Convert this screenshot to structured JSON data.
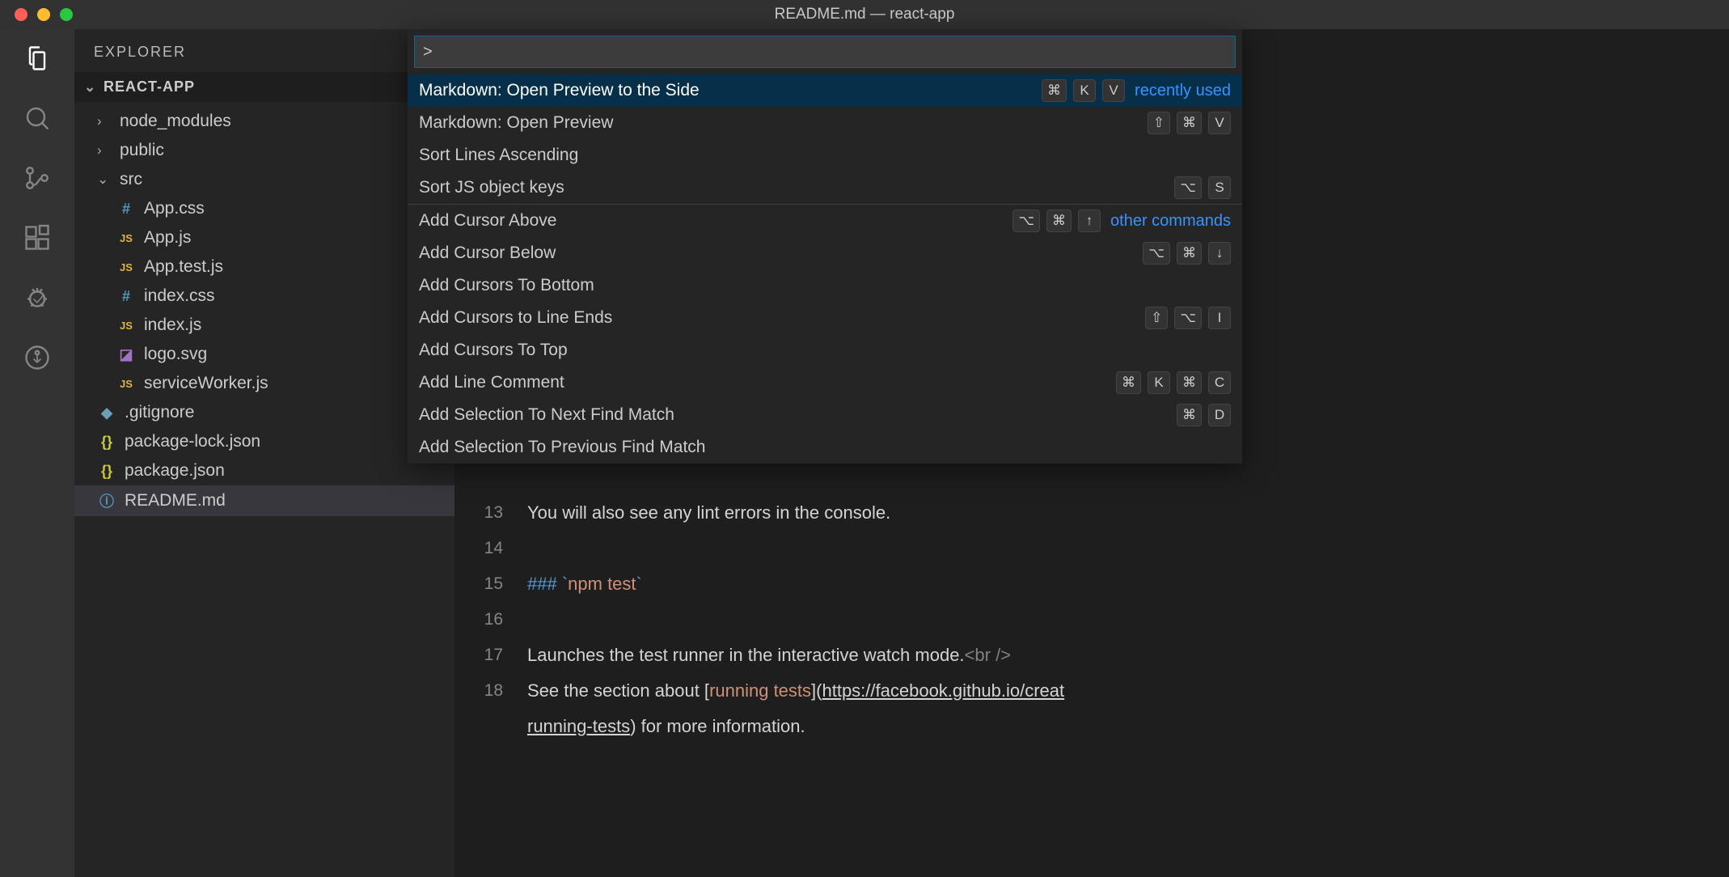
{
  "window": {
    "title": "README.md — react-app"
  },
  "sidebar": {
    "title": "EXPLORER",
    "project": "REACT-APP",
    "tree": {
      "node_modules": "node_modules",
      "public": "public",
      "src": "src",
      "app_css": "App.css",
      "app_js": "App.js",
      "app_test_js": "App.test.js",
      "index_css": "index.css",
      "index_js": "index.js",
      "logo_svg": "logo.svg",
      "service_worker": "serviceWorker.js",
      "gitignore": ".gitignore",
      "pkg_lock": "package-lock.json",
      "pkg": "package.json",
      "readme": "README.md"
    }
  },
  "palette": {
    "input": ">",
    "hints": {
      "recent": "recently used",
      "other": "other commands"
    },
    "items": [
      {
        "label": "Markdown: Open Preview to the Side",
        "keys": [
          "⌘",
          "K",
          "V"
        ],
        "sel": true,
        "hint": "recent"
      },
      {
        "label": "Markdown: Open Preview",
        "keys": [
          "⇧",
          "⌘",
          "V"
        ]
      },
      {
        "label": "Sort Lines Ascending",
        "keys": []
      },
      {
        "label": "Sort JS object keys",
        "keys": [
          "⌥",
          "S"
        ],
        "sep_after": true
      },
      {
        "label": "Add Cursor Above",
        "keys": [
          "⌥",
          "⌘",
          "↑"
        ],
        "hint": "other"
      },
      {
        "label": "Add Cursor Below",
        "keys": [
          "⌥",
          "⌘",
          "↓"
        ]
      },
      {
        "label": "Add Cursors To Bottom",
        "keys": []
      },
      {
        "label": "Add Cursors to Line Ends",
        "keys": [
          "⇧",
          "⌥",
          "I"
        ]
      },
      {
        "label": "Add Cursors To Top",
        "keys": []
      },
      {
        "label": "Add Line Comment",
        "keys": [
          "⌘",
          "K",
          "⌘",
          "C"
        ]
      },
      {
        "label": "Add Selection To Next Find Match",
        "keys": [
          "⌘",
          "D"
        ]
      },
      {
        "label": "Add Selection To Previous Find Match",
        "keys": []
      }
    ]
  },
  "editor": {
    "lines": [
      {
        "n": "13",
        "segs": [
          {
            "t": "You will also see any lint errors in the console.",
            "c": ""
          }
        ]
      },
      {
        "n": "14",
        "segs": [
          {
            "t": "",
            "c": ""
          }
        ]
      },
      {
        "n": "15",
        "segs": [
          {
            "t": "### ",
            "c": "mk-h"
          },
          {
            "t": "`",
            "c": "mk-h"
          },
          {
            "t": "npm test",
            "c": "mk-code"
          },
          {
            "t": "`",
            "c": "mk-h"
          }
        ]
      },
      {
        "n": "16",
        "segs": [
          {
            "t": "",
            "c": ""
          }
        ]
      },
      {
        "n": "17",
        "segs": [
          {
            "t": "Launches the test runner in the interactive watch mode.",
            "c": ""
          },
          {
            "t": "<br />",
            "c": "mk-tag"
          }
        ]
      },
      {
        "n": "18",
        "segs": [
          {
            "t": "See the section about [",
            "c": ""
          },
          {
            "t": "running tests",
            "c": "mk-link"
          },
          {
            "t": "](",
            "c": ""
          },
          {
            "t": "https://facebook.github.io/creat",
            "c": "mk-url"
          }
        ]
      },
      {
        "n": "",
        "segs": [
          {
            "t": "running-tests",
            "c": "mk-url"
          },
          {
            "t": ") for more information.",
            "c": ""
          }
        ],
        "cont": true
      }
    ]
  }
}
